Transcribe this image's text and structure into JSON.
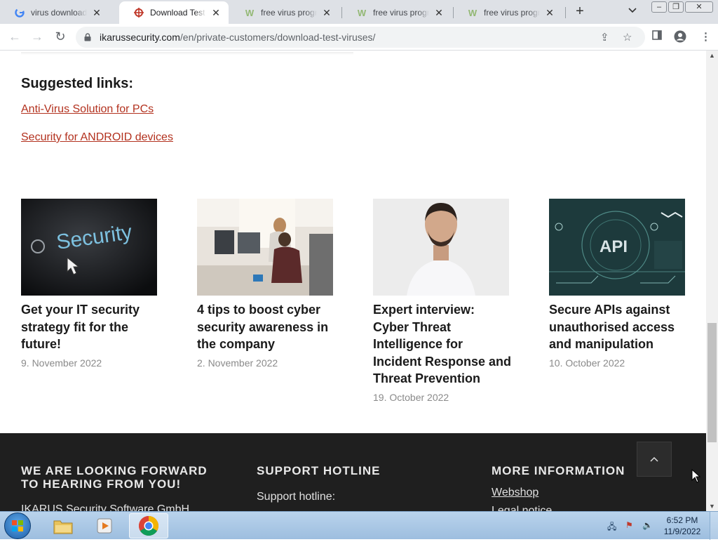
{
  "browser": {
    "tabs": [
      {
        "title": "virus download - Google Search",
        "favicon": "google-icon",
        "active": false
      },
      {
        "title": "Download Test Viruses",
        "favicon": "ikarus-icon",
        "active": true
      },
      {
        "title": "free virus programs",
        "favicon": "wikihow-icon",
        "active": false
      },
      {
        "title": "free virus programs",
        "favicon": "wikihow-icon",
        "active": false
      },
      {
        "title": "free virus programs",
        "favicon": "wikihow-icon",
        "active": false
      }
    ],
    "url_domain": "ikarussecurity.com",
    "url_path": "/en/private-customers/download-test-viruses/"
  },
  "page": {
    "suggested_heading": "Suggested links:",
    "suggested_links": [
      "Anti-Virus Solution for PCs",
      "Security for ANDROID devices"
    ],
    "articles": [
      {
        "title": "Get your IT security strategy fit for the future!",
        "date": "9. November 2022",
        "image_text": "Security"
      },
      {
        "title": "4 tips to boost cyber security awareness in the company",
        "date": "2. November 2022"
      },
      {
        "title": "Expert interview: Cyber Threat Intelligence for Incident Response and Threat Prevention",
        "date": "19. October 2022"
      },
      {
        "title": "Secure APIs against unauthorised access and manipulation",
        "date": "10. October 2022",
        "image_text": "API"
      }
    ],
    "footer": {
      "col1_heading": "WE ARE LOOKING FORWARD TO HEARING FROM YOU!",
      "col1_text": "IKARUS Security Software GmbH",
      "col2_heading": "SUPPORT HOTLINE",
      "col2_text": "Support hotline:",
      "col3_heading": "MORE INFORMATION",
      "col3_links": [
        "Webshop",
        "Legal notice"
      ]
    }
  },
  "taskbar": {
    "time": "6:52 PM",
    "date": "11/9/2022"
  }
}
